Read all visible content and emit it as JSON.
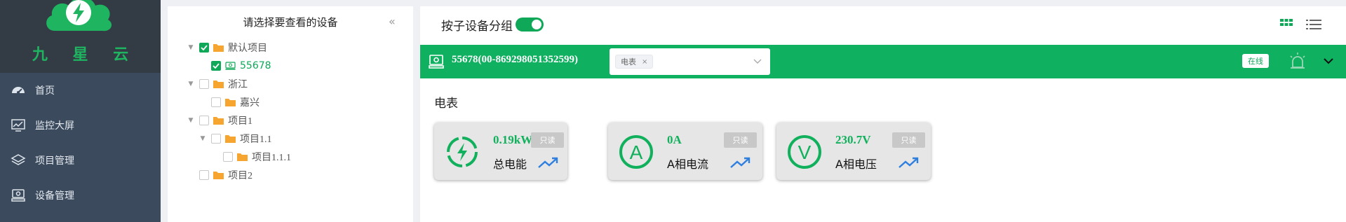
{
  "brand": {
    "name": "九 星 云",
    "color": "#1fb460"
  },
  "sidebar": {
    "items": [
      {
        "label": "首页",
        "icon": "dashboard-icon"
      },
      {
        "label": "监控大屏",
        "icon": "monitor-icon"
      },
      {
        "label": "项目管理",
        "icon": "layers-icon"
      },
      {
        "label": "设备管理",
        "icon": "device-icon"
      }
    ]
  },
  "tree": {
    "title": "请选择要查看的设备",
    "collapse_icon": "«",
    "nodes": [
      {
        "label": "默认项目",
        "checked": true
      },
      {
        "label": "55678",
        "checked": true
      },
      {
        "label": "浙江",
        "checked": false
      },
      {
        "label": "嘉兴",
        "checked": false
      },
      {
        "label": "项目1",
        "checked": false
      },
      {
        "label": "项目1.1",
        "checked": false
      },
      {
        "label": "项目1.1.1",
        "checked": false
      },
      {
        "label": "项目2",
        "checked": false
      }
    ]
  },
  "main": {
    "group_label": "按子设备分组",
    "group_toggle_on": true,
    "device": {
      "name": "55678(00-869298051352599)",
      "selected_tag": "电表",
      "tag_remove": "×",
      "status": "在线"
    },
    "section_title": "电表",
    "cards": [
      {
        "value": "0.19kWh",
        "name": "总电能",
        "badge": "只读",
        "gauge_icon": "lightning-gauge-icon"
      },
      {
        "value": "0A",
        "name": "A相电流",
        "badge": "只读",
        "gauge_icon": "ampere-gauge-icon"
      },
      {
        "value": "230.7V",
        "name": "A相电压",
        "badge": "只读",
        "gauge_icon": "volt-gauge-icon"
      }
    ]
  },
  "colors": {
    "accent": "#0fb05f",
    "sidebar_bg": "#3b4a5d",
    "logo_bg": "#333b45",
    "trend_blue": "#2f7fe0"
  }
}
